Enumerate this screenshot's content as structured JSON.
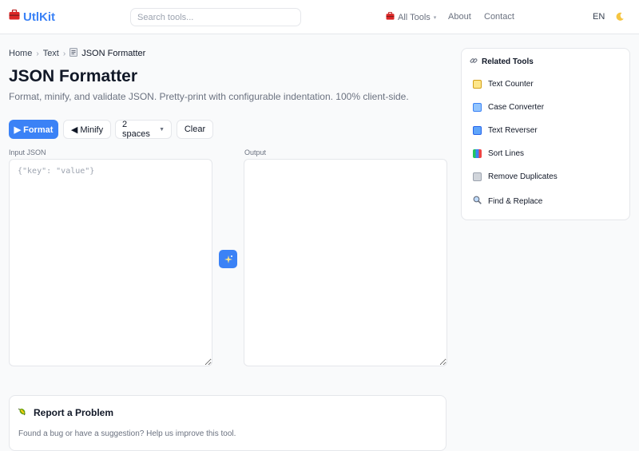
{
  "colors": {
    "accent": "#3b82f6",
    "border": "#e5e7eb",
    "muted": "#6b7280",
    "background": "#f9fafb"
  },
  "header": {
    "logo_text": "UtlKit",
    "logo_icon": "toolbox-icon",
    "search_placeholder": "Search tools...",
    "nav": {
      "all_tools": "All Tools",
      "about": "About",
      "contact": "Contact"
    },
    "language": "EN",
    "theme_icon": "moon-icon"
  },
  "breadcrumb": {
    "home": "Home",
    "category": "Text",
    "current": "JSON Formatter"
  },
  "page": {
    "title": "JSON Formatter",
    "subtitle": "Format, minify, and validate JSON. Pretty-print with configurable indentation. 100% client-side."
  },
  "toolbar": {
    "format_label": "▶ Format",
    "minify_label": "◀ Minify",
    "indent_selected": "2 spaces",
    "clear_label": "Clear"
  },
  "editor": {
    "input_label": "Input JSON",
    "input_placeholder": "{\"key\": \"value\"}",
    "input_value": "",
    "output_label": "Output",
    "output_value": "",
    "swap_icon": "sparkle-icon"
  },
  "related_tools": {
    "title": "Related Tools",
    "title_icon": "link-icon",
    "items": [
      {
        "label": "Text Counter",
        "icon": "memo-icon"
      },
      {
        "label": "Case Converter",
        "icon": "abc-icon"
      },
      {
        "label": "Text Reverser",
        "icon": "reverse-icon"
      },
      {
        "label": "Sort Lines",
        "icon": "bar-chart-icon"
      },
      {
        "label": "Remove Duplicates",
        "icon": "trash-icon"
      },
      {
        "label": "Find & Replace",
        "icon": "magnifier-icon"
      }
    ]
  },
  "report": {
    "title": "Report a Problem",
    "icon": "bug-icon",
    "subtitle": "Found a bug or have a suggestion? Help us improve this tool."
  }
}
